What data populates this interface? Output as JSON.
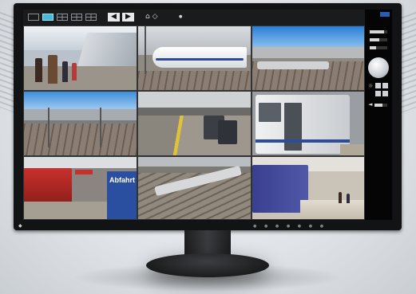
{
  "toolbar": {
    "layout_buttons": [
      "layout-1x1",
      "layout-2x2-active",
      "layout-wide",
      "layout-3x3",
      "layout-4x4"
    ],
    "prev_symbol": "◀",
    "next_symbol": "▶",
    "network_symbol": "⌂ ◇",
    "dot_symbol": "●"
  },
  "cameras": [
    {
      "id": "cam-1",
      "scene": "platform-crowd-train"
    },
    {
      "id": "cam-2",
      "scene": "bullet-train-rails"
    },
    {
      "id": "cam-3",
      "scene": "station-yard-overview"
    },
    {
      "id": "cam-4",
      "scene": "station-rail-yard"
    },
    {
      "id": "cam-5",
      "scene": "platform-benches"
    },
    {
      "id": "cam-6",
      "scene": "train-door-platform"
    },
    {
      "id": "cam-7",
      "scene": "red-train-platform"
    },
    {
      "id": "cam-8",
      "scene": "aerial-tracks"
    },
    {
      "id": "cam-9",
      "scene": "blue-train-platform"
    }
  ],
  "signs": {
    "cam7_sign": "Abfahrt"
  },
  "side_panel": {
    "slider_levels": [
      0.8,
      0.55,
      0.35
    ],
    "volume_level": 0.6,
    "icons": [
      "brightness-icon",
      "speaker-icon"
    ]
  },
  "colors": {
    "accent": "#47b8d7",
    "bezel": "#121314",
    "brand_blue": "#2c5bb5"
  },
  "bezel": {
    "badge_symbol": "◆"
  }
}
